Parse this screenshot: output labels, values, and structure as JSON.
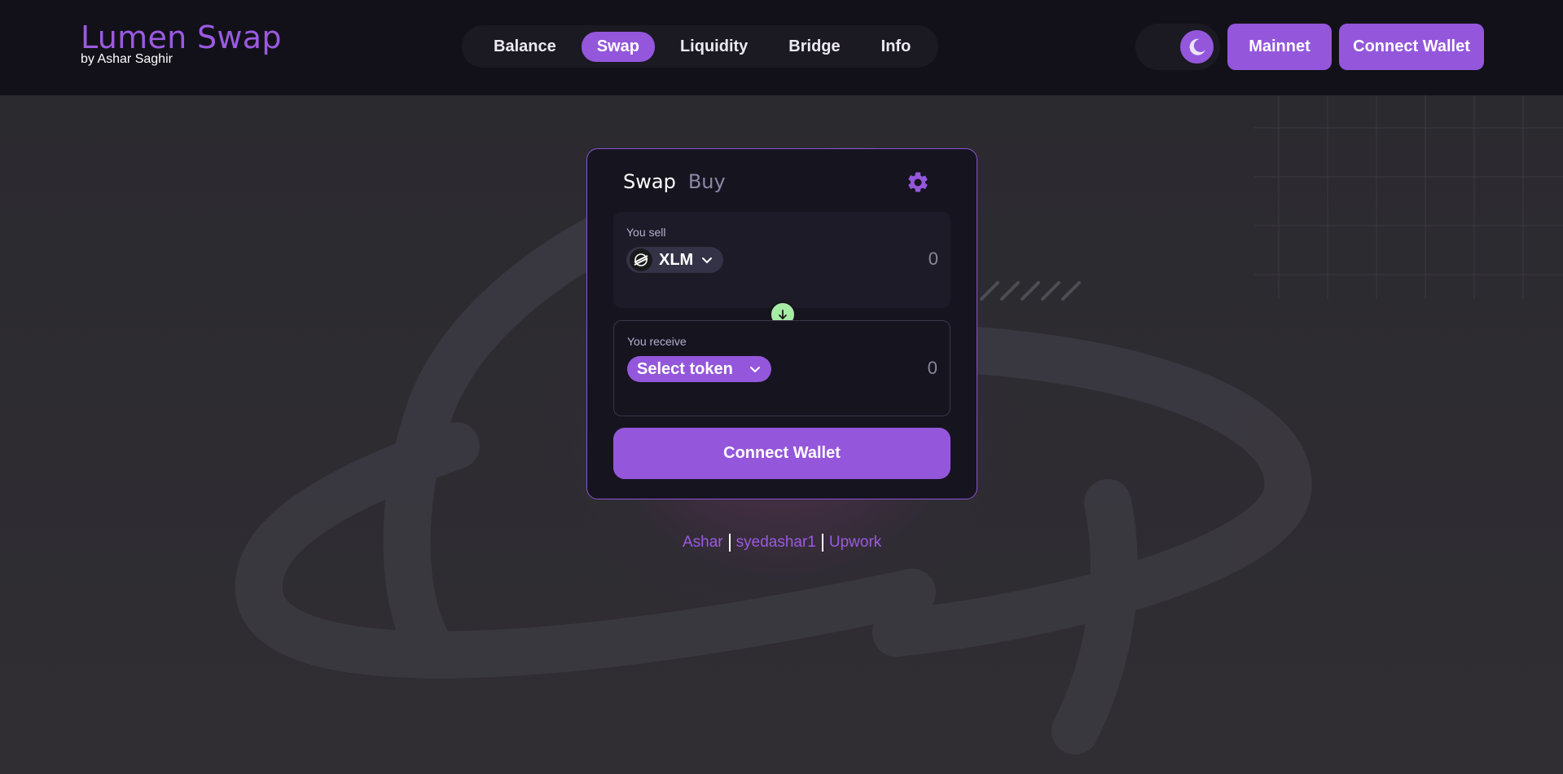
{
  "brand": {
    "title": "Lumen Swap",
    "subtitle": "by Ashar Saghir"
  },
  "nav": {
    "items": [
      {
        "label": "Balance",
        "active": false
      },
      {
        "label": "Swap",
        "active": true
      },
      {
        "label": "Liquidity",
        "active": false
      },
      {
        "label": "Bridge",
        "active": false
      },
      {
        "label": "Info",
        "active": false
      }
    ]
  },
  "header": {
    "theme_icon": "moon-icon",
    "network_label": "Mainnet",
    "connect_label": "Connect Wallet"
  },
  "card": {
    "tabs": [
      {
        "label": "Swap",
        "active": true
      },
      {
        "label": "Buy",
        "active": false
      }
    ],
    "settings_icon": "gear-icon",
    "sell": {
      "label": "You sell",
      "token": "XLM",
      "amount": "0"
    },
    "receive": {
      "label": "You receive",
      "token_placeholder": "Select token",
      "amount": "0"
    },
    "direction_icon": "arrow-down-icon",
    "cta_label": "Connect Wallet"
  },
  "footer": {
    "links": [
      "Ashar",
      "syedashar1",
      "Upwork"
    ]
  },
  "colors": {
    "accent": "#9457db",
    "brand_text": "#9b5ae0",
    "direction_button": "#a7eba7",
    "header_bg": "#121119"
  }
}
